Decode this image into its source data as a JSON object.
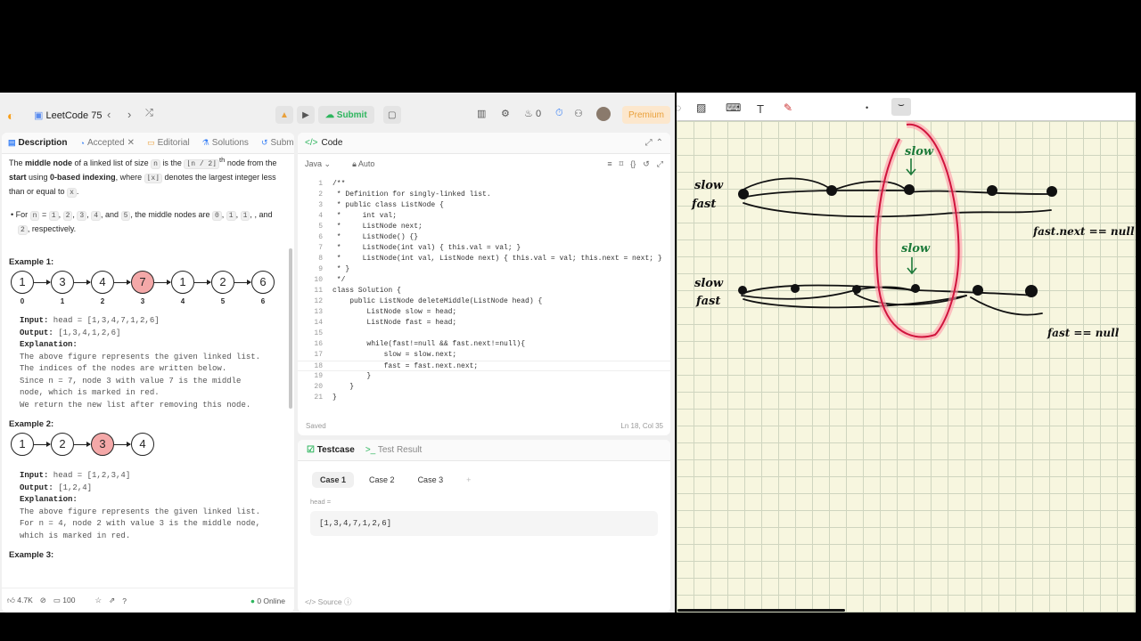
{
  "app": {
    "name": "LeetCode 75",
    "submit_label": "Submit",
    "streak": "0",
    "premium_label": "Premium"
  },
  "desc_tabs": [
    {
      "label": "Description"
    },
    {
      "label": "Accepted"
    },
    {
      "label": "Editorial"
    },
    {
      "label": "Solutions"
    },
    {
      "label": "Subm"
    }
  ],
  "description": {
    "p1_a": "The ",
    "p1_b": "middle node",
    "p1_c": " of a linked list of size ",
    "p1_n": "n",
    "p1_d": " is the ",
    "p1_e": "⌊n / 2⌋",
    "p1_f": "th",
    "p1_g": " node from the ",
    "p1_h": "start",
    "p1_i": " using ",
    "p1_j": "0-based indexing",
    "p1_k": ", where ",
    "p1_l": "⌊x⌋",
    "p1_m": " denotes the largest integer less than or equal to ",
    "p1_x": "x",
    "p1_end": ".",
    "bullet_a": "For ",
    "bullet_n": "n",
    "bullet_b": " = ",
    "bullet_vals": [
      "1",
      "2",
      "3",
      "4"
    ],
    "bullet_c": ", and ",
    "bullet_5": "5",
    "bullet_d": ", the middle nodes are ",
    "bullet_mids": [
      "0",
      "1",
      "1",
      "2"
    ],
    "bullet_e": ", and ",
    "bullet_2": "2",
    "bullet_f": ", respectively."
  },
  "example1": {
    "title": "Example 1:",
    "nodes": [
      "1",
      "3",
      "4",
      "7",
      "1",
      "2",
      "6"
    ],
    "indices": [
      "0",
      "1",
      "2",
      "3",
      "4",
      "5",
      "6"
    ],
    "red_index": 3,
    "input_label": "Input:",
    "input": " head = [1,3,4,7,1,2,6]",
    "output_label": "Output:",
    "output": " [1,3,4,1,2,6]",
    "explanation_label": "Explanation:",
    "explanation": "The above figure represents the given linked list.\nThe indices of the nodes are written below.\nSince n = 7, node 3 with value 7 is the middle\nnode, which is marked in red.\nWe return the new list after removing this node."
  },
  "example2": {
    "title": "Example 2:",
    "nodes": [
      "1",
      "2",
      "3",
      "4"
    ],
    "red_index": 2,
    "input_label": "Input:",
    "input": " head = [1,2,3,4]",
    "output_label": "Output:",
    "output": " [1,2,4]",
    "explanation_label": "Explanation:",
    "explanation": "The above figure represents the given linked list.\nFor n = 4, node 2 with value 3 is the middle node,\nwhich is marked in red."
  },
  "example3": {
    "title": "Example 3:"
  },
  "desc_footer": {
    "likes": "4.7K",
    "comments": "100",
    "online": "0 Online"
  },
  "code_panel": {
    "title": "Code",
    "language": "Java",
    "mode": "Auto",
    "saved": "Saved",
    "cursor": "Ln 18, Col 35"
  },
  "code_lines": [
    "/**",
    " * Definition for singly-linked list.",
    " * public class ListNode {",
    " *     int val;",
    " *     ListNode next;",
    " *     ListNode() {}",
    " *     ListNode(int val) { this.val = val; }",
    " *     ListNode(int val, ListNode next) { this.val = val; this.next = next; }",
    " * }",
    " */",
    "class Solution {",
    "    public ListNode deleteMiddle(ListNode head) {",
    "        ListNode slow = head;",
    "        ListNode fast = head;",
    "",
    "        while(fast!=null && fast.next!=null){",
    "            slow = slow.next;",
    "            fast = fast.next.next;",
    "        }",
    "    }",
    "}"
  ],
  "testcase": {
    "tab_testcase": "Testcase",
    "tab_result": "Test Result",
    "cases": [
      "Case 1",
      "Case 2",
      "Case 3"
    ],
    "head_label": "head =",
    "head_value": "[1,3,4,7,1,2,6]",
    "source": "Source"
  },
  "whiteboard": {
    "row1_labels": [
      "slow",
      "fast"
    ],
    "row1_slow_label": "slow",
    "row1_note": "fast.next == null",
    "row2_labels": [
      "slow",
      "fast"
    ],
    "row2_slow_label": "slow",
    "row2_note": "fast == null"
  }
}
